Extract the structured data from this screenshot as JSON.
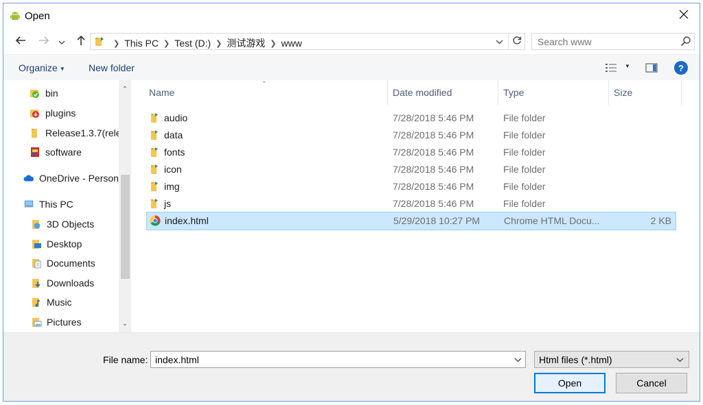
{
  "window": {
    "title": "Open",
    "app_icon": "android-icon"
  },
  "toolbar": {
    "breadcrumbs": [
      "This PC",
      "Test (D:)",
      "测试游戏",
      "www"
    ],
    "search_placeholder": "Search www"
  },
  "commands": {
    "organize": "Organize",
    "new_folder": "New folder"
  },
  "nav": {
    "items": [
      {
        "label": "bin",
        "icon": "green-check-folder-icon"
      },
      {
        "label": "plugins",
        "icon": "red-arrow-folder-icon"
      },
      {
        "label": "Release1.3.7(rele",
        "icon": "folder-icon"
      },
      {
        "label": "software",
        "icon": "app-shortcut-icon"
      },
      {
        "label": "OneDrive - Person",
        "icon": "cloud-icon"
      },
      {
        "label": "This PC",
        "icon": "computer-icon"
      },
      {
        "label": "3D Objects",
        "icon": "3d-objects-icon"
      },
      {
        "label": "Desktop",
        "icon": "desktop-folder-icon"
      },
      {
        "label": "Documents",
        "icon": "documents-folder-icon"
      },
      {
        "label": "Downloads",
        "icon": "downloads-folder-icon"
      },
      {
        "label": "Music",
        "icon": "music-folder-icon"
      },
      {
        "label": "Pictures",
        "icon": "pictures-folder-icon"
      }
    ]
  },
  "files": {
    "columns": [
      "Name",
      "Date modified",
      "Type",
      "Size"
    ],
    "rows": [
      {
        "name": "audio",
        "date": "7/28/2018 5:46 PM",
        "type": "File folder",
        "size": "",
        "icon": "folder-icon"
      },
      {
        "name": "data",
        "date": "7/28/2018 5:46 PM",
        "type": "File folder",
        "size": "",
        "icon": "folder-icon"
      },
      {
        "name": "fonts",
        "date": "7/28/2018 5:46 PM",
        "type": "File folder",
        "size": "",
        "icon": "folder-icon"
      },
      {
        "name": "icon",
        "date": "7/28/2018 5:46 PM",
        "type": "File folder",
        "size": "",
        "icon": "folder-icon"
      },
      {
        "name": "img",
        "date": "7/28/2018 5:46 PM",
        "type": "File folder",
        "size": "",
        "icon": "folder-icon"
      },
      {
        "name": "js",
        "date": "7/28/2018 5:46 PM",
        "type": "File folder",
        "size": "",
        "icon": "folder-icon"
      },
      {
        "name": "index.html",
        "date": "5/29/2018 10:27 PM",
        "type": "Chrome HTML Docu...",
        "size": "2 KB",
        "icon": "chrome-icon",
        "selected": true
      }
    ]
  },
  "footer": {
    "file_name_label": "File name:",
    "file_name_value": "index.html",
    "filter_value": "Html files (*.html)",
    "open_label": "Open",
    "cancel_label": "Cancel"
  },
  "colors": {
    "accent": "#0078d7",
    "selection": "#cce8ff",
    "folder": "#f4c652"
  }
}
